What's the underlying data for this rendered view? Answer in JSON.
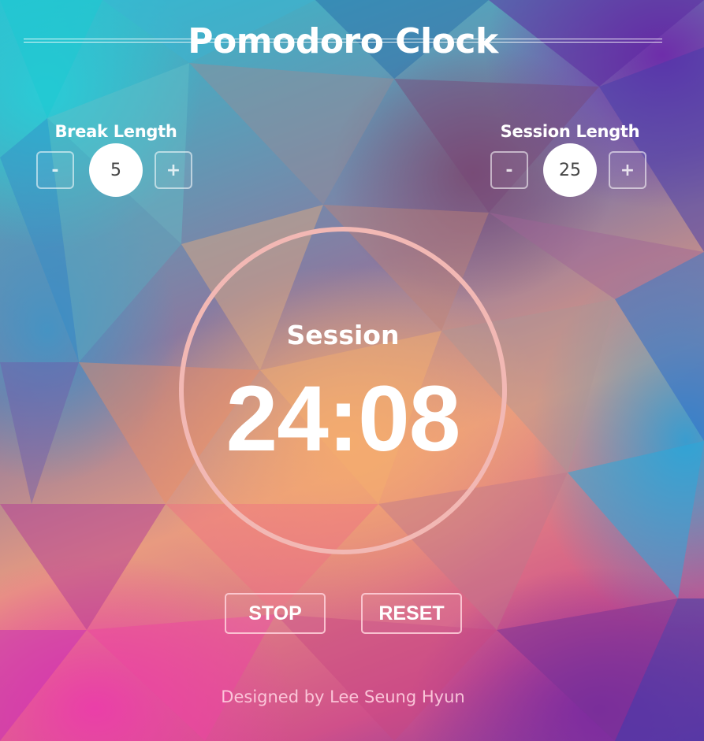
{
  "app": {
    "title": "Pomodoro Clock"
  },
  "break": {
    "label": "Break Length",
    "value": "5",
    "decrement_label": "-",
    "increment_label": "+"
  },
  "session": {
    "label": "Session Length",
    "value": "25",
    "decrement_label": "-",
    "increment_label": "+"
  },
  "timer": {
    "mode_label": "Session",
    "time": "24:08"
  },
  "controls": {
    "stop_label": "STOP",
    "reset_label": "RESET"
  },
  "footer": {
    "credit": "Designed by Lee Seung Hyun"
  },
  "colors": {
    "ring": "#f2b8b4",
    "text": "#ffffff",
    "value_circle": "#ffffff"
  }
}
